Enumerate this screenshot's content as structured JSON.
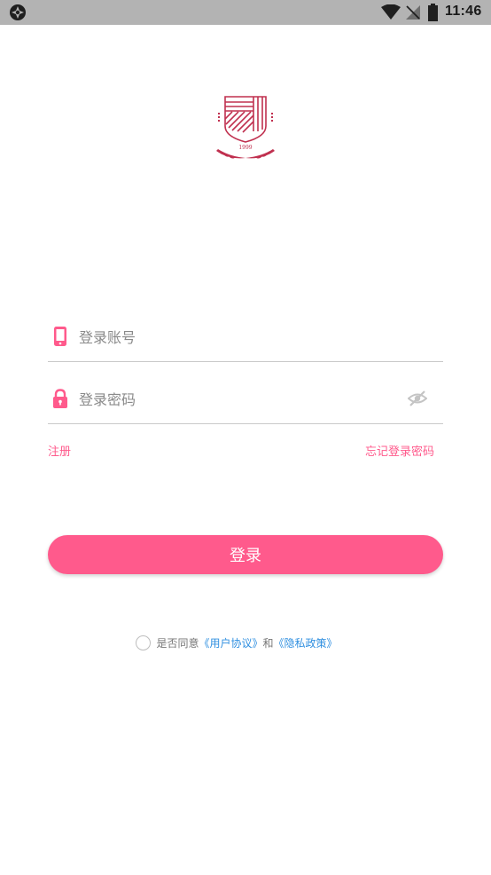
{
  "status_bar": {
    "time": "11:46",
    "icons": [
      "app-notification-icon",
      "wifi-icon",
      "no-signal-icon",
      "battery-icon"
    ]
  },
  "logo": {
    "year": "1999",
    "color": "#c0304f"
  },
  "form": {
    "account_placeholder": "登录账号",
    "password_placeholder": "登录密码",
    "register_label": "注册",
    "forgot_label": "忘记登录密码",
    "login_label": "登录"
  },
  "agreement": {
    "prefix": "是否同意",
    "user_agreement": "《用户协议》",
    "conjunction": "和",
    "privacy_policy": "《隐私政策》",
    "checked": false
  },
  "colors": {
    "accent": "#ff5a8c",
    "link_blue": "#2f8fe0",
    "status_bar_bg": "#b3b3b3"
  }
}
